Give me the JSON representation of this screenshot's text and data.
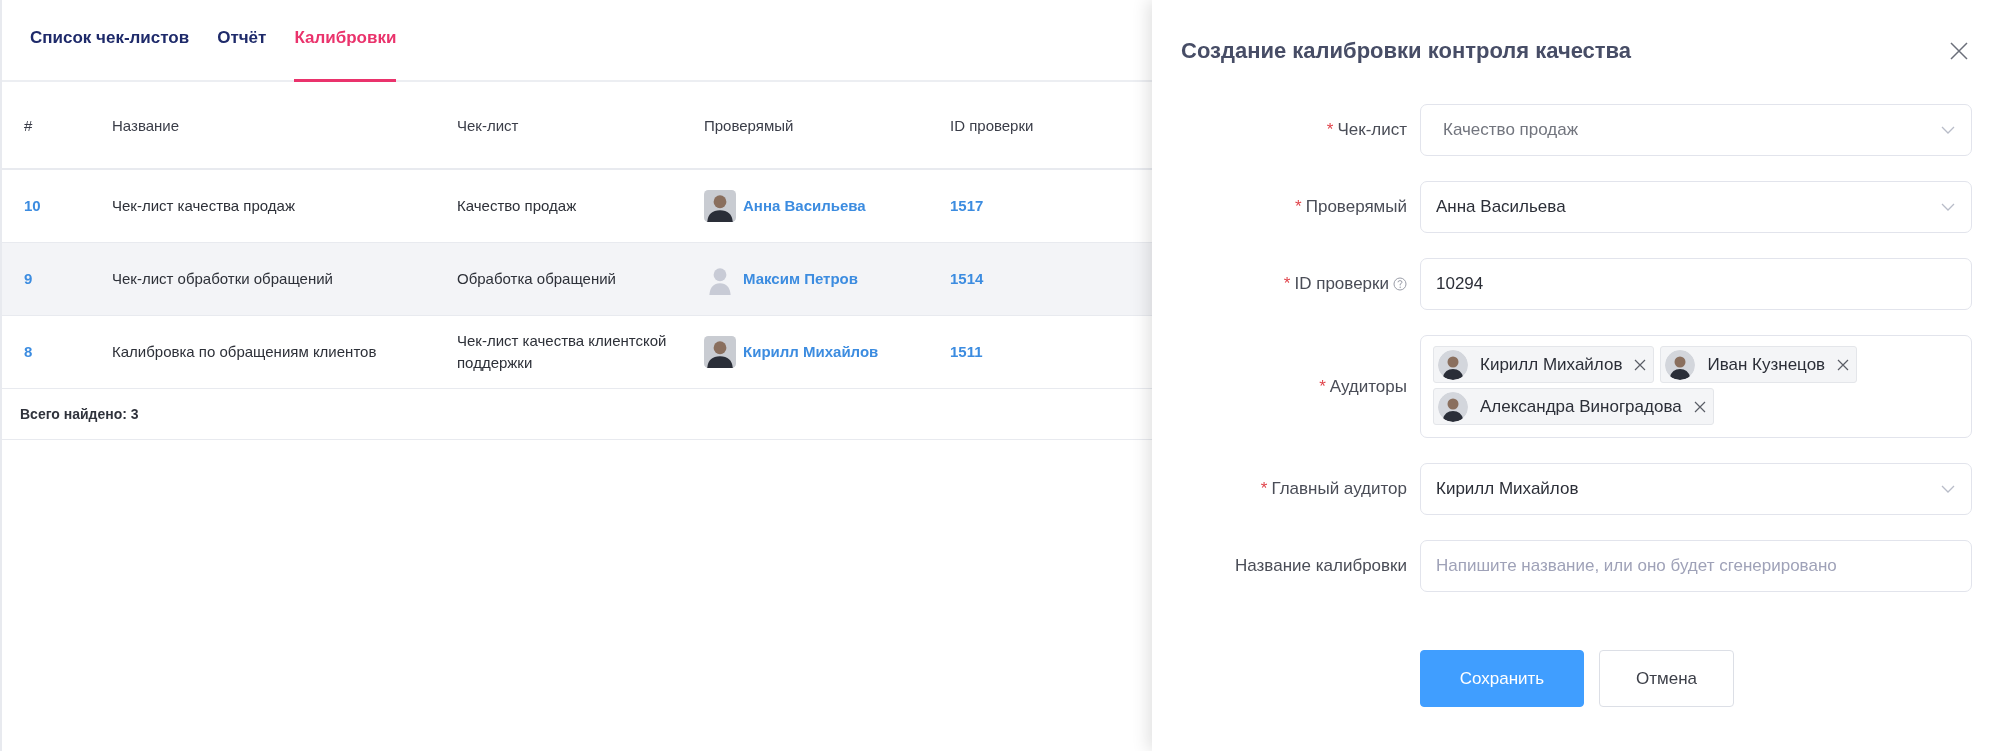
{
  "tabs": [
    {
      "label": "Список чек-листов",
      "selected": false
    },
    {
      "label": "Отчёт",
      "selected": false
    },
    {
      "label": "Калибровки",
      "selected": true
    }
  ],
  "table": {
    "columns": [
      "#",
      "Название",
      "Чек-лист",
      "Проверямый",
      "ID проверки"
    ],
    "rows": [
      {
        "number": "10",
        "name": "Чек-лист качества продаж",
        "checklist": "Качество продаж",
        "person": "Анна Васильева",
        "kind": "photo",
        "check_id": "1517",
        "highlighted": false
      },
      {
        "number": "9",
        "name": "Чек-лист обработки обращений",
        "checklist": "Обработка обращений",
        "person": "Максим Петров",
        "kind": "default",
        "check_id": "1514",
        "highlighted": true
      },
      {
        "number": "8",
        "name": "Калибровка по обращениям клиентов",
        "checklist": "Чек-лист качества клиентской поддержки",
        "person": "Кирилл Михайлов",
        "kind": "photo",
        "check_id": "1511",
        "highlighted": false
      }
    ],
    "footer": "Всего найдено: 3"
  },
  "drawer": {
    "title": "Создание калибровки контроля качества",
    "fields": [
      {
        "kind": "select",
        "required_mark": "*",
        "label": "Чек-лист",
        "help": false,
        "value": "Качество продаж",
        "disabled": true
      },
      {
        "kind": "select",
        "required_mark": "*",
        "label": "Проверямый",
        "help": false,
        "value": "Анна Васильева",
        "disabled": false
      },
      {
        "kind": "input",
        "required_mark": "*",
        "label": "ID проверки",
        "help": true,
        "value": "10294",
        "disabled": false
      },
      {
        "kind": "tags",
        "required_mark": "*",
        "label": "Аудиторы",
        "help": false,
        "tags": [
          "Кирилл Михайлов",
          "Иван Кузнецов",
          "Александра Виноградова"
        ]
      },
      {
        "kind": "select",
        "required_mark": "*",
        "label": "Главный аудитор",
        "help": false,
        "value": "Кирилл Михайлов",
        "disabled": false
      },
      {
        "kind": "input",
        "label": "Название калибровки",
        "help": false,
        "placeholder": "Напишите название, или оно будет сгенерировано"
      }
    ],
    "buttons": [
      {
        "label": "Сохранить",
        "kind": "primary"
      },
      {
        "label": "Отмена",
        "kind": "default"
      }
    ]
  }
}
